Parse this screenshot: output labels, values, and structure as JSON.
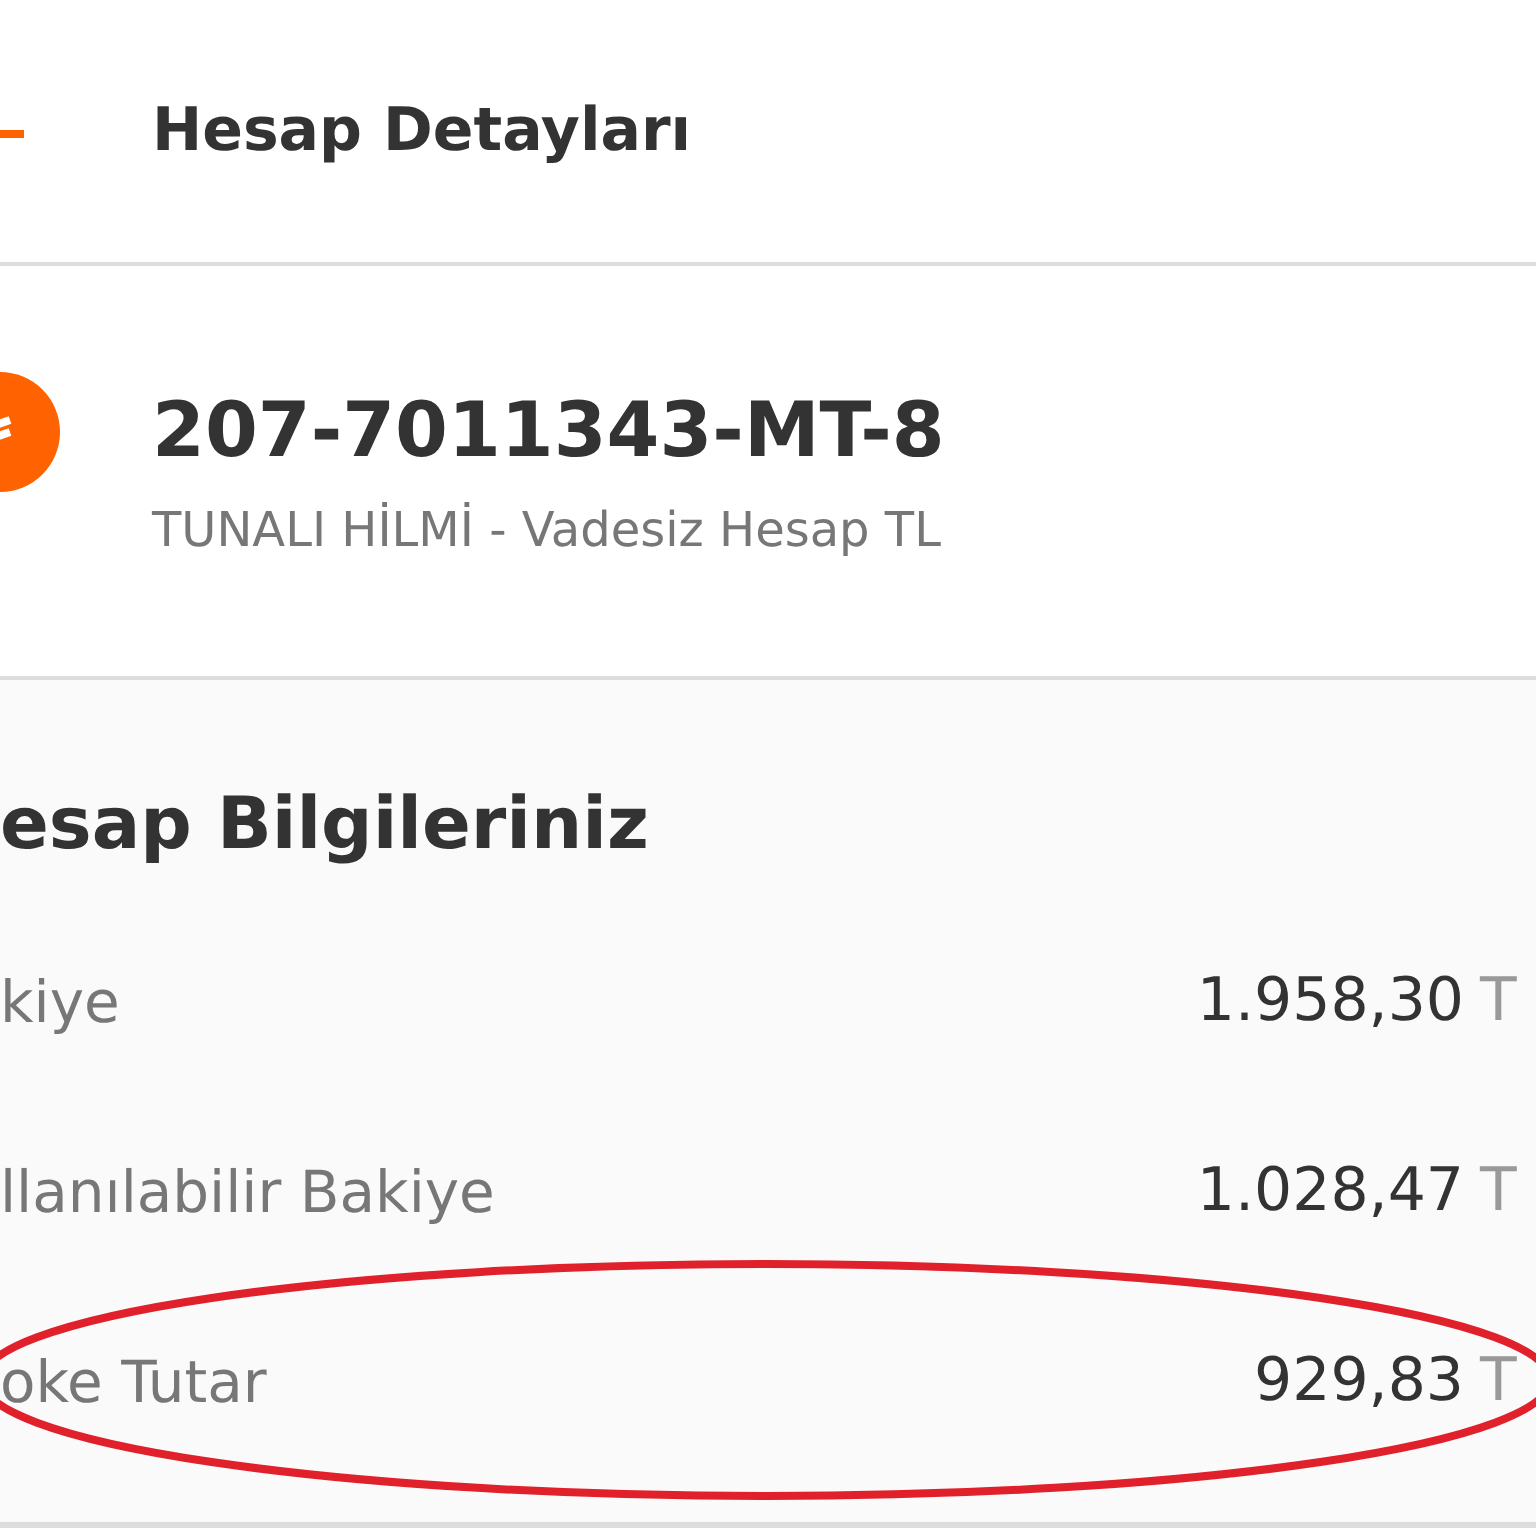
{
  "header": {
    "title": "Hesap Detayları"
  },
  "account": {
    "number": "207-7011343-MT-8",
    "description": "TUNALI HİLMİ - Vadesiz Hesap TL"
  },
  "section": {
    "title": "esap Bilgileriniz",
    "rows": [
      {
        "label": "kiye",
        "value": "1.958,30",
        "currency": "T",
        "highlighted": false
      },
      {
        "label": "llanılabilir Bakiye",
        "value": "1.028,47",
        "currency": "T",
        "highlighted": false
      },
      {
        "label": "oke Tutar",
        "value": "929,83",
        "currency": "T",
        "highlighted": true
      }
    ]
  }
}
